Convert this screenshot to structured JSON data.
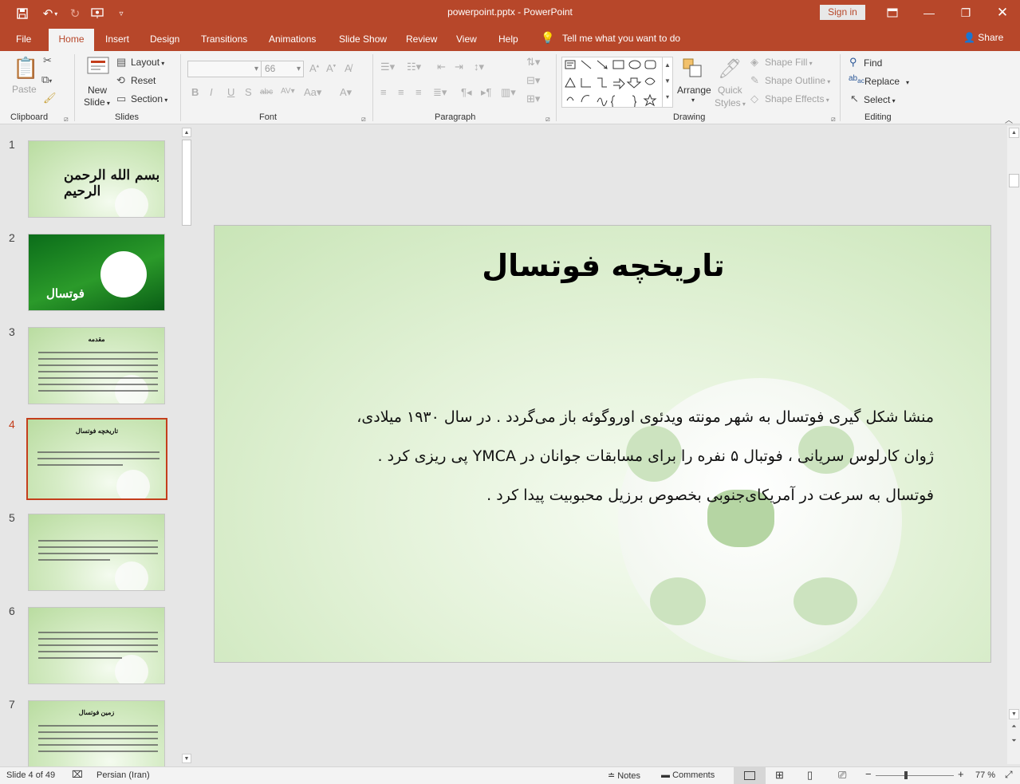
{
  "app": {
    "title": "powerpoint.pptx  -  PowerPoint",
    "signin_label": "Sign in",
    "accent_color": "#b7472a"
  },
  "tabs": [
    {
      "label": "File"
    },
    {
      "label": "Home"
    },
    {
      "label": "Insert"
    },
    {
      "label": "Design"
    },
    {
      "label": "Transitions"
    },
    {
      "label": "Animations"
    },
    {
      "label": "Slide Show"
    },
    {
      "label": "Review"
    },
    {
      "label": "View"
    },
    {
      "label": "Help"
    }
  ],
  "tell_me": "Tell me what you want to do",
  "share_label": "Share",
  "ribbon": {
    "clipboard": {
      "label": "Clipboard",
      "paste": "Paste"
    },
    "slides": {
      "label": "Slides",
      "new_slide_1": "New",
      "new_slide_2": "Slide",
      "layout": "Layout",
      "reset": "Reset",
      "section": "Section"
    },
    "font": {
      "label": "Font",
      "font_name": "",
      "font_size": "66"
    },
    "paragraph": {
      "label": "Paragraph"
    },
    "drawing": {
      "label": "Drawing",
      "arrange": "Arrange",
      "quick_styles_1": "Quick",
      "quick_styles_2": "Styles",
      "shape_fill": "Shape Fill",
      "shape_outline": "Shape Outline",
      "shape_effects": "Shape Effects"
    },
    "editing": {
      "label": "Editing",
      "find": "Find",
      "replace": "Replace",
      "select": "Select"
    }
  },
  "thumbnails": [
    {
      "num": "1"
    },
    {
      "num": "2",
      "title": "فوتسال"
    },
    {
      "num": "3",
      "title": "مقدمه"
    },
    {
      "num": "4",
      "title": "تاریخچه فوتسال"
    },
    {
      "num": "5"
    },
    {
      "num": "6"
    },
    {
      "num": "7",
      "title": "زمین فوتسال"
    }
  ],
  "slide": {
    "title": "تاریخچه فوتسال",
    "body_lines": [
      "منشا شکل گیری فوتسال به شهر مونته ویدئوی اوروگوئه باز می‌گردد . در سال ۱۹۳۰ میلادی،",
      "ژوان کارلوس سریانی ، فوتبال ۵ نفره را برای مسابقات جوانان در YMCA پی ریزی کرد .",
      "فوتسال به سرعت در آمریکای‌جنوبی بخصوص برزیل محبوبیت پیدا کرد ."
    ]
  },
  "status": {
    "slide_info": "Slide 4 of 49",
    "language": "Persian (Iran)",
    "notes": "Notes",
    "comments": "Comments",
    "zoom": "77 %"
  }
}
